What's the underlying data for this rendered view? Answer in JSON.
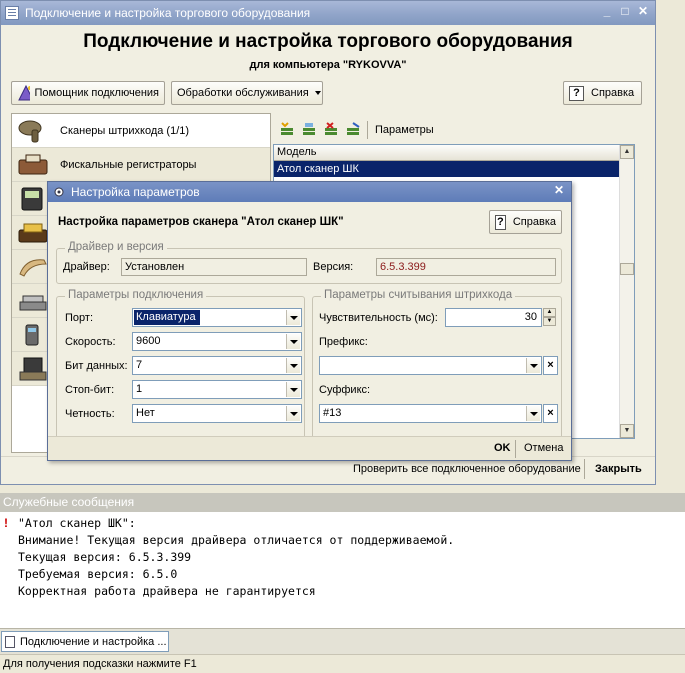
{
  "window": {
    "title": "Подключение и настройка торгового оборудования",
    "heading": "Подключение и настройка торгового оборудования",
    "subheading": "для компьютера \"RYKOVVA\"",
    "min_glyph": "_",
    "max_glyph": "□",
    "close_glyph": "✕"
  },
  "toolbar": {
    "wizard_label": "Помощник подключения",
    "service_label": "Обработки обслуживания",
    "help_label": "Справка",
    "params_label": "Параметры"
  },
  "device_list": [
    {
      "label": "Сканеры штрихкода (1/1)",
      "icon": "barcode-scanner-icon"
    },
    {
      "label": "Фискальные регистраторы",
      "icon": "fiscal-printer-icon"
    },
    {
      "label": "",
      "icon": "data-terminal-icon"
    },
    {
      "label": "",
      "icon": "card-reader-icon"
    },
    {
      "label": "",
      "icon": "customer-display-icon"
    },
    {
      "label": "",
      "icon": "scales-icon"
    },
    {
      "label": "",
      "icon": "receipt-printer-icon"
    },
    {
      "label": "",
      "icon": "pos-terminal-icon"
    }
  ],
  "grid": {
    "header": "Модель",
    "rows": [
      "Атол сканер ШК"
    ]
  },
  "footer": {
    "check_all": "Проверить все подключенное оборудование",
    "close": "Закрыть"
  },
  "dialog": {
    "title": "Настройка параметров",
    "heading": "Настройка параметров сканера \"Атол сканер ШК\"",
    "help_label": "Справка",
    "driver_group": "Драйвер и версия",
    "driver_label": "Драйвер:",
    "driver_value": "Установлен",
    "version_label": "Версия:",
    "version_value": "6.5.3.399",
    "conn_group": "Параметры подключения",
    "port_label": "Порт:",
    "port_value": "Клавиатура",
    "speed_label": "Скорость:",
    "speed_value": "9600",
    "databits_label": "Бит данных:",
    "databits_value": "7",
    "stopbit_label": "Стоп-бит:",
    "stopbit_value": "1",
    "parity_label": "Четность:",
    "parity_value": "Нет",
    "read_group": "Параметры считывания штрихкода",
    "sens_label": "Чувствительность (мс):",
    "sens_value": "30",
    "prefix_label": "Префикс:",
    "prefix_value": "",
    "suffix_label": "Суффикс:",
    "suffix_value": "#13",
    "ok_label": "OK",
    "cancel_label": "Отмена"
  },
  "messages": {
    "title": "Служебные сообщения",
    "marker": "!",
    "lines": [
      "\"Атол сканер ШК\":",
      "Внимание! Текущая версия драйвера отличается от поддерживаемой.",
      "Текущая версия: 6.5.3.399",
      "Требуемая версия: 6.5.0",
      "Корректная работа драйвера не гарантируется"
    ]
  },
  "taskbar": {
    "item_label": "Подключение и настройка ..."
  },
  "status": {
    "hint": "Для получения подсказки нажмите F1"
  },
  "colors": {
    "selection": "#0a246a",
    "version_text": "#8b1a1a",
    "warning": "#cc0000"
  }
}
